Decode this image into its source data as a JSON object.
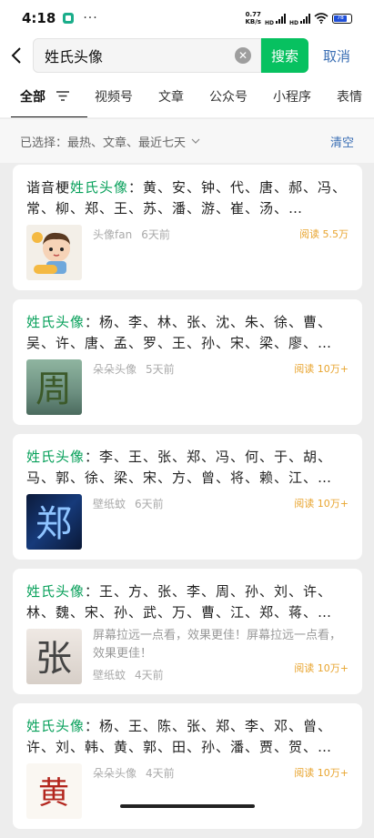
{
  "status_bar": {
    "time": "4:18",
    "net_speed_value": "0.77",
    "net_speed_unit": "KB/s",
    "battery_level": "78"
  },
  "search": {
    "query": "姓氏头像",
    "search_label": "搜索",
    "cancel_label": "取消"
  },
  "tabs": [
    "全部",
    "视频号",
    "文章",
    "公众号",
    "小程序",
    "表情"
  ],
  "filter": {
    "selected_text": "已选择：最热、文章、最近七天",
    "clear_label": "清空"
  },
  "results": [
    {
      "title_prefix": "谐音梗",
      "title_highlight": "姓氏头像",
      "title_rest": "：黄、安、钟、代、唐、郝、冯、常、柳、郑、王、苏、潘、游、崔、汤、…",
      "source": "头像fan",
      "time": "6天前",
      "reads": "阅读 5.5万",
      "desc": ""
    },
    {
      "title_prefix": "",
      "title_highlight": "姓氏头像",
      "title_rest": "：杨、李、林、张、沈、朱、徐、曹、吴、许、唐、孟、罗、王、孙、宋、梁、廖、…",
      "source": "朵朵头像",
      "time": "5天前",
      "reads": "阅读 10万+",
      "desc": ""
    },
    {
      "title_prefix": "",
      "title_highlight": "姓氏头像",
      "title_rest": "：李、王、张、郑、冯、何、于、胡、马、郭、徐、梁、宋、方、曾、将、赖、江、…",
      "source": "壁纸蚊",
      "time": "6天前",
      "reads": "阅读 10万+",
      "desc": ""
    },
    {
      "title_prefix": "",
      "title_highlight": "姓氏头像",
      "title_rest": "：王、方、张、李、周、孙、刘、许、林、魏、宋、孙、武、万、曹、江、郑、蒋、…",
      "source": "壁纸蚊",
      "time": "4天前",
      "reads": "阅读 10万+",
      "desc": "屏幕拉远一点看，效果更佳！屏幕拉远一点看，效果更佳！"
    },
    {
      "title_prefix": "",
      "title_highlight": "姓氏头像",
      "title_rest": "：杨、王、陈、张、郑、李、邓、曾、许、刘、韩、黄、郭、田、孙、潘、贾、贺、…",
      "source": "朵朵头像",
      "time": "4天前",
      "reads": "阅读 10万+",
      "desc": ""
    }
  ],
  "thumb_glyphs": {
    "t2": "周",
    "t3": "郑",
    "t4": "张",
    "t5": "黄"
  },
  "colors": {
    "accent_green": "#07c160",
    "link_blue": "#3b6fb4",
    "read_orange": "#e8a42e"
  }
}
